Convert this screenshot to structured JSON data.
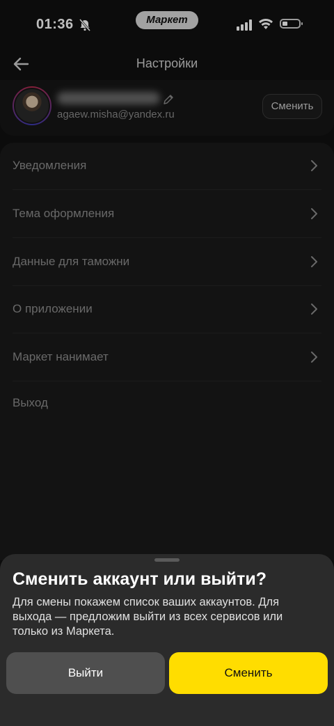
{
  "status_bar": {
    "time": "01:36",
    "app_pill": "Маркет"
  },
  "header": {
    "title": "Настройки"
  },
  "profile": {
    "email": "agaew.misha@yandex.ru",
    "switch_label": "Сменить"
  },
  "menu": {
    "items": [
      {
        "label": "Уведомления"
      },
      {
        "label": "Тема оформления"
      },
      {
        "label": "Данные для таможни"
      },
      {
        "label": "О приложении"
      },
      {
        "label": "Маркет нанимает"
      },
      {
        "label": "Выход"
      }
    ]
  },
  "sheet": {
    "title": "Сменить аккаунт или выйти?",
    "text": "Для смены покажем список ваших аккаунтов. Для выхода — предложим выйти из всех сервисов или только из Маркета.",
    "exit_label": "Выйти",
    "switch_label": "Сменить"
  },
  "colors": {
    "accent": "#ffdd00",
    "background": "#101010",
    "sheet": "#2b2b2b"
  }
}
